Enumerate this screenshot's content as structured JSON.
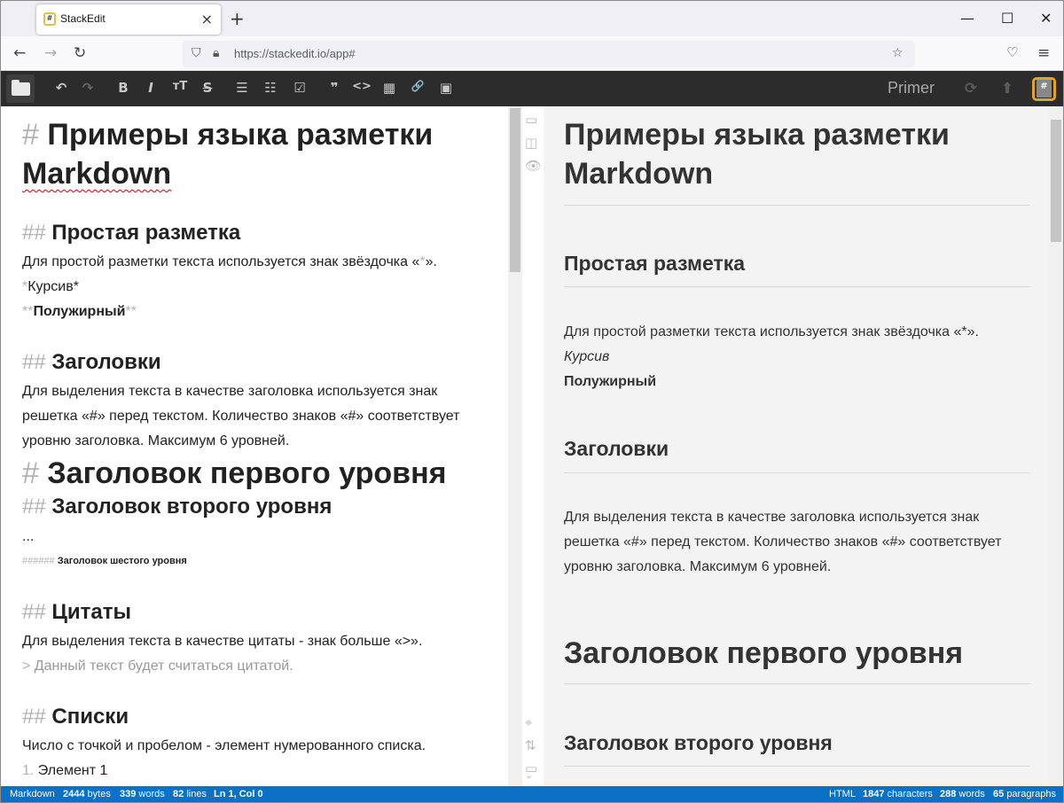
{
  "browser": {
    "tab_title": "StackEdit",
    "tab_favicon": "#",
    "new_tab": "+",
    "url": "https://stackedit.io/app#"
  },
  "toolbar": {
    "doc_title": "Primer",
    "logo": "#",
    "buttons": [
      {
        "name": "undo-icon",
        "glyph": "↶"
      },
      {
        "name": "redo-icon",
        "glyph": "↷"
      },
      {
        "name": "bold-icon",
        "glyph": "B"
      },
      {
        "name": "italic-icon",
        "glyph": "I"
      },
      {
        "name": "heading-icon",
        "glyph": "тT"
      },
      {
        "name": "strikethrough-icon",
        "glyph": "S"
      },
      {
        "name": "bullet-list-icon",
        "glyph": "☰"
      },
      {
        "name": "numbered-list-icon",
        "glyph": "☷"
      },
      {
        "name": "check-list-icon",
        "glyph": "☑"
      },
      {
        "name": "quote-icon",
        "glyph": "❞"
      },
      {
        "name": "code-icon",
        "glyph": "<>"
      },
      {
        "name": "table-icon",
        "glyph": "▦"
      },
      {
        "name": "link-icon",
        "glyph": "🔗"
      },
      {
        "name": "image-icon",
        "glyph": "▣"
      }
    ]
  },
  "editor": {
    "h1_mark": "#",
    "title_line1": "Примеры языка разметки",
    "title_line2": "Markdown",
    "s1_mark": "##",
    "s1_title": "Простая разметка",
    "s1_text_before": "Для простой разметки текста используется знак звёздочка «",
    "s1_text_star": "*",
    "s1_text_after": "».",
    "italic_mark_open": "*",
    "italic_text": "Курсив*",
    "bold_mark_open": "**",
    "bold_text": "Полужирный",
    "bold_mark_close": "**",
    "s2_mark": "##",
    "s2_title": "Заголовки",
    "s2_line1": "Для выделения текста в качестве заголовка используется знак",
    "s2_line2": "решетка «#» перед текстом. Количество знаков «#» соответствует",
    "s2_line3": "уровню заголовка. Максимум 6 уровней.",
    "h1_example_mark": "#",
    "h1_example": "Заголовок первого уровня",
    "h2_example_mark": "##",
    "h2_example": "Заголовок второго уровня",
    "ellipsis": "...",
    "h6_example_mark": "######",
    "h6_example": "Заголовок шестого уровня",
    "s3_mark": "##",
    "s3_title": "Цитаты",
    "s3_text": "Для выделения текста в качестве цитаты - знак больше «>».",
    "s3_quote_mark": ">",
    "s3_quote": "Данный текст будет считаться цитатой.",
    "s4_mark": "##",
    "s4_title": "Списки",
    "s4_text": "Число с точкой и пробелом - элемент нумерованного списка.",
    "s4_item_mark": "1.",
    "s4_item": "Элемент 1"
  },
  "preview": {
    "title_line1": "Примеры языка разметки",
    "title_line2": "Markdown",
    "s1_title": "Простая разметка",
    "s1_text": "Для простой разметки текста используется знак звёздочка «*».",
    "italic_text": "Курсив",
    "bold_text": "Полужирный",
    "s2_title": "Заголовки",
    "s2_line1": "Для выделения текста в качестве заголовка используется знак",
    "s2_line2": "решетка «#» перед текстом. Количество знаков «#» соответствует",
    "s2_line3": "уровню заголовка. Максимум 6 уровней.",
    "h1_example": "Заголовок первого уровня",
    "h2_example": "Заголовок второго уровня"
  },
  "status": {
    "left_mode": "Markdown",
    "bytes": "2444",
    "bytes_label": "bytes",
    "words": "339",
    "words_label": "words",
    "lines": "82",
    "lines_label": "lines",
    "cursor": "Ln 1, Col 0",
    "right_mode": "HTML",
    "characters": "1847",
    "characters_label": "characters",
    "preview_words": "288",
    "preview_words_label": "words",
    "paragraphs": "65",
    "paragraphs_label": "paragraphs"
  },
  "colors": {
    "toolbar_bg": "#2c2c2c",
    "status_bg": "#0a71c4",
    "preview_bg": "#f3f3f3",
    "markdown_mark": "#b2b2b2",
    "logo_accent": "#e8a31c"
  }
}
